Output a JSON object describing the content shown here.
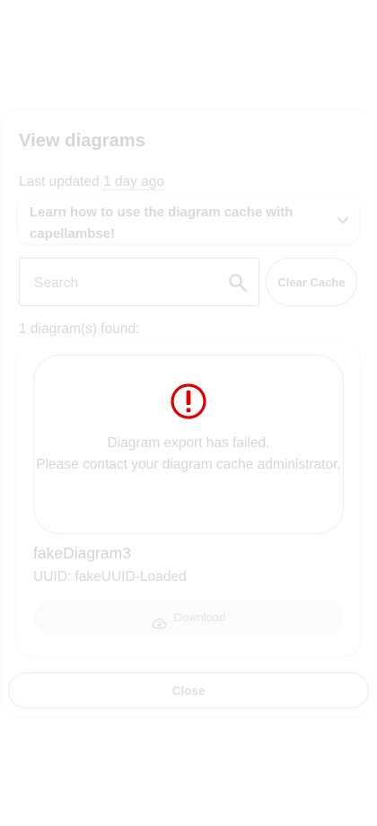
{
  "dialog": {
    "title": "View diagrams",
    "last_updated_label": "Last updated",
    "last_updated_value": "1 day ago",
    "learn_panel": {
      "text": "Learn how to use the diagram cache with capellambse!",
      "icon": "chevron-down-icon"
    },
    "search": {
      "placeholder": "Search",
      "value": "",
      "icon": "search-icon"
    },
    "clear_cache_label": "Clear Cache",
    "found_count": "1 diagram(s) found:",
    "diagrams": [
      {
        "error_icon": "error-icon",
        "error_color": "#e00000",
        "error_line1": "Diagram export has failed.",
        "error_line2": "Please contact your diagram cache administrator.",
        "name": "fakeDiagram3",
        "uuid": "UUID: fakeUUID-Loaded",
        "download_label": "Download",
        "download_icon": "cloud-download-icon"
      }
    ],
    "close_label": "Close"
  }
}
